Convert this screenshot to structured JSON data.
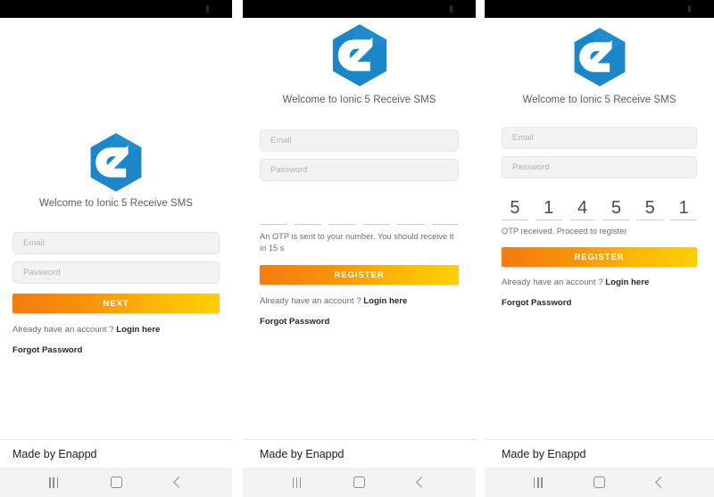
{
  "app": {
    "brand_blue": "#1b87c9",
    "cta_gradient_from": "#f47b10",
    "cta_gradient_to": "#fdcf03",
    "logo_name": "enappd-hexagon-logo"
  },
  "footer": {
    "made_by": "Made by Enappd"
  },
  "navbar": {
    "recents_label": "recents",
    "home_label": "home",
    "back_label": "back"
  },
  "common": {
    "welcome": "Welcome to Ionic 5 Receive SMS",
    "email_placeholder": "Email",
    "password_placeholder": "Password",
    "account_prefix": "Already have an account ? ",
    "login_here": "Login here",
    "forgot_password": "Forgot Password"
  },
  "panels": [
    {
      "id": "signup-step-1",
      "cta_label": "NEXT",
      "otp_visible": false,
      "otp_digits": [],
      "otp_note": ""
    },
    {
      "id": "otp-sent",
      "cta_label": "REGISTER",
      "otp_visible": true,
      "otp_digits": [
        "",
        "",
        "",
        "",
        "",
        ""
      ],
      "otp_note": "An OTP is sent to your number. You should receive it in 15 s"
    },
    {
      "id": "otp-received",
      "cta_label": "REGISTER",
      "otp_visible": true,
      "otp_digits": [
        "5",
        "1",
        "4",
        "5",
        "5",
        "1"
      ],
      "otp_note": "OTP received. Proceed to register"
    }
  ]
}
